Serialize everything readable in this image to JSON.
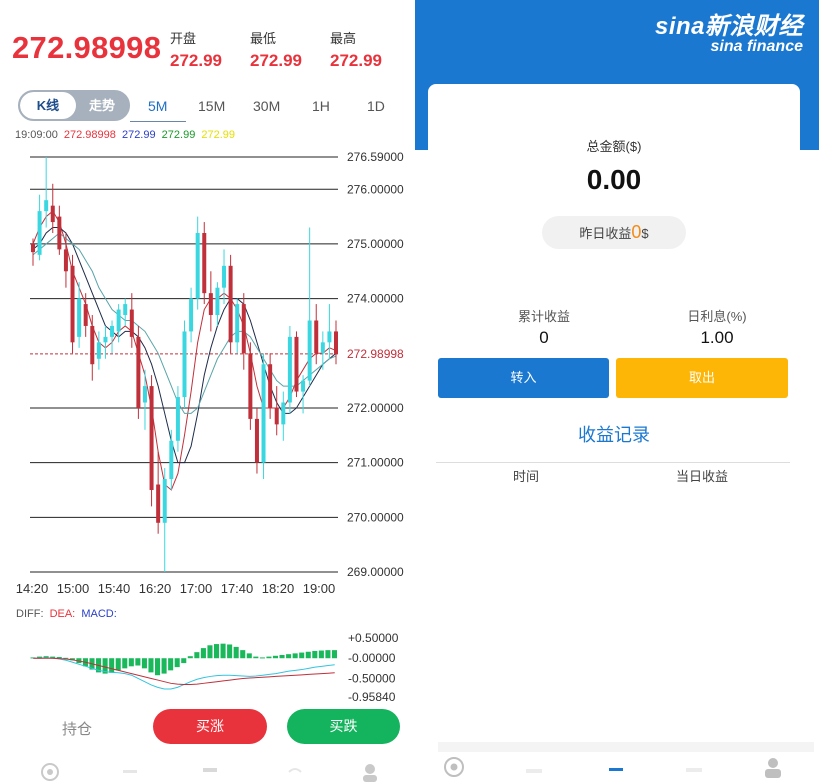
{
  "quote": {
    "price": "272.98998",
    "open_label": "开盘",
    "open_value": "272.99",
    "low_label": "最低",
    "low_value": "272.99",
    "high_label": "最高",
    "high_value": "272.99"
  },
  "chart_toggle": {
    "kline": "K线",
    "trend": "走势"
  },
  "timeframes": [
    "5M",
    "15M",
    "30M",
    "1H",
    "1D"
  ],
  "ma_legend": {
    "time": "19:09:00",
    "v1": "272.98998",
    "v1_color": "#e8333c",
    "v2": "272.99",
    "v2_color": "#2a3fc8",
    "v3": "272.99",
    "v3_color": "#1a9a2a",
    "v4": "272.99",
    "v4_color": "#e6e000"
  },
  "chart_data": [
    {
      "type": "candlestick",
      "title": "",
      "y_tick_labels": [
        "276.59000",
        "276.00000",
        "275.00000",
        "274.00000",
        "272.98998",
        "272.00000",
        "271.00000",
        "270.00000",
        "269.00000"
      ],
      "x_tick_labels": [
        "14:20",
        "15:00",
        "15:40",
        "16:20",
        "17:00",
        "17:40",
        "18:20",
        "19:00"
      ],
      "ylim": [
        269.0,
        276.59
      ],
      "current_price": 272.98998,
      "up_color": "#3ad7e0",
      "down_color": "#c0303a",
      "candles": [
        [
          275.0,
          275.1,
          274.6,
          274.85
        ],
        [
          274.8,
          275.9,
          274.7,
          275.6
        ],
        [
          275.6,
          276.59,
          275.3,
          275.8
        ],
        [
          275.7,
          276.1,
          275.2,
          275.4
        ],
        [
          275.5,
          275.7,
          274.8,
          274.9
        ],
        [
          274.9,
          275.2,
          274.2,
          274.5
        ],
        [
          274.6,
          274.8,
          273.0,
          273.2
        ],
        [
          273.3,
          274.3,
          273.1,
          274.0
        ],
        [
          273.9,
          274.1,
          273.3,
          273.5
        ],
        [
          273.5,
          273.7,
          272.5,
          272.8
        ],
        [
          272.9,
          273.4,
          272.7,
          273.2
        ],
        [
          273.2,
          273.5,
          272.9,
          273.3
        ],
        [
          273.3,
          273.6,
          273.0,
          273.5
        ],
        [
          273.4,
          273.9,
          273.2,
          273.8
        ],
        [
          273.7,
          274.0,
          273.5,
          273.9
        ],
        [
          273.8,
          274.1,
          273.1,
          273.3
        ],
        [
          273.3,
          273.5,
          271.8,
          272.0
        ],
        [
          272.1,
          272.7,
          271.6,
          272.4
        ],
        [
          272.4,
          272.6,
          270.2,
          270.5
        ],
        [
          270.6,
          271.2,
          269.7,
          269.9
        ],
        [
          269.9,
          270.9,
          269.0,
          270.7
        ],
        [
          270.7,
          271.6,
          270.5,
          271.4
        ],
        [
          271.4,
          272.4,
          271.2,
          272.2
        ],
        [
          272.2,
          273.6,
          272.0,
          273.4
        ],
        [
          273.4,
          274.2,
          273.2,
          274.0
        ],
        [
          274.0,
          275.5,
          273.8,
          275.2
        ],
        [
          275.2,
          275.4,
          273.9,
          274.1
        ],
        [
          274.1,
          274.5,
          273.4,
          273.7
        ],
        [
          273.7,
          274.3,
          273.5,
          274.2
        ],
        [
          274.2,
          274.9,
          273.9,
          274.6
        ],
        [
          274.6,
          274.8,
          273.0,
          273.2
        ],
        [
          273.2,
          274.0,
          273.0,
          273.9
        ],
        [
          273.9,
          274.1,
          272.7,
          273.0
        ],
        [
          273.0,
          273.2,
          271.6,
          271.8
        ],
        [
          271.8,
          272.0,
          270.8,
          271.0
        ],
        [
          271.0,
          273.0,
          270.7,
          272.8
        ],
        [
          272.8,
          273.0,
          271.8,
          272.0
        ],
        [
          272.0,
          272.4,
          271.5,
          271.7
        ],
        [
          271.7,
          272.3,
          271.4,
          272.1
        ],
        [
          272.1,
          273.5,
          271.9,
          273.3
        ],
        [
          273.3,
          273.4,
          272.2,
          272.3
        ],
        [
          272.3,
          272.6,
          271.9,
          272.5
        ],
        [
          272.5,
          275.3,
          272.4,
          273.6
        ],
        [
          273.6,
          273.9,
          272.8,
          273.0
        ],
        [
          273.0,
          273.4,
          272.7,
          273.2
        ],
        [
          273.2,
          273.9,
          272.9,
          273.4
        ],
        [
          273.4,
          273.6,
          272.8,
          272.99
        ]
      ],
      "ma_series": [
        {
          "color": "#c0303a",
          "values": [
            275.0,
            275.3,
            275.5,
            275.6,
            275.4,
            275.0,
            274.5,
            274.2,
            273.9,
            273.5,
            273.2,
            273.1,
            273.2,
            273.4,
            273.5,
            273.4,
            273.0,
            272.6,
            272.0,
            271.2,
            270.6,
            270.5,
            270.8,
            271.5,
            272.3,
            273.2,
            273.8,
            274.0,
            274.0,
            274.1,
            274.0,
            273.8,
            273.5,
            273.0,
            272.4,
            272.0,
            272.0,
            272.0,
            272.0,
            272.2,
            272.5,
            272.7,
            272.9,
            273.0,
            273.0,
            273.1,
            273.05
          ]
        },
        {
          "color": "#1d2b4a",
          "values": [
            274.9,
            275.0,
            275.2,
            275.3,
            275.3,
            275.2,
            275.0,
            274.7,
            274.4,
            274.1,
            273.8,
            273.5,
            273.4,
            273.3,
            273.4,
            273.4,
            273.3,
            273.1,
            272.8,
            272.4,
            271.9,
            271.4,
            271.0,
            271.0,
            271.3,
            271.9,
            272.6,
            273.1,
            273.5,
            273.8,
            274.0,
            274.0,
            273.9,
            273.6,
            273.2,
            272.8,
            272.4,
            272.1,
            271.9,
            271.9,
            272.0,
            272.2,
            272.4,
            272.6,
            272.8,
            272.9,
            273.0
          ]
        },
        {
          "color": "#5aa4a8",
          "values": [
            274.8,
            274.9,
            275.0,
            275.1,
            275.2,
            275.1,
            275.0,
            274.9,
            274.7,
            274.5,
            274.2,
            274.0,
            273.8,
            273.7,
            273.6,
            273.6,
            273.5,
            273.4,
            273.2,
            273.0,
            272.7,
            272.4,
            272.1,
            271.9,
            271.9,
            272.0,
            272.3,
            272.6,
            272.9,
            273.1,
            273.3,
            273.4,
            273.4,
            273.3,
            273.1,
            272.9,
            272.7,
            272.5,
            272.4,
            272.4,
            272.4,
            272.5,
            272.6,
            272.7,
            272.8,
            272.9,
            272.95
          ]
        }
      ]
    },
    {
      "type": "bar",
      "title": "MACD",
      "legend": [
        "DIFF:",
        "DEA:",
        "MACD:"
      ],
      "legend_colors": [
        "#555555",
        "#e8333c",
        "#2a3fc8"
      ],
      "y_tick_labels": [
        "+0.50000",
        "-0.00000",
        "-0.50000",
        "-0.95840"
      ],
      "ylim": [
        -0.9584,
        0.5
      ],
      "positive_color": "#19b85a",
      "negative_color": "#19b85a",
      "values": [
        0.02,
        0.04,
        0.05,
        0.04,
        0.03,
        0.01,
        -0.05,
        -0.12,
        -0.2,
        -0.28,
        -0.35,
        -0.38,
        -0.36,
        -0.3,
        -0.25,
        -0.2,
        -0.18,
        -0.25,
        -0.35,
        -0.42,
        -0.38,
        -0.3,
        -0.22,
        -0.12,
        0.05,
        0.15,
        0.25,
        0.32,
        0.35,
        0.36,
        0.34,
        0.28,
        0.2,
        0.12,
        0.04,
        0.02,
        0.04,
        0.06,
        0.08,
        0.1,
        0.12,
        0.14,
        0.16,
        0.18,
        0.19,
        0.2,
        0.2
      ],
      "diff_values": [
        0.0,
        0.0,
        0.01,
        0.0,
        -0.02,
        -0.05,
        -0.1,
        -0.15,
        -0.2,
        -0.25,
        -0.3,
        -0.33,
        -0.35,
        -0.36,
        -0.38,
        -0.42,
        -0.5,
        -0.58,
        -0.66,
        -0.72,
        -0.76,
        -0.76,
        -0.72,
        -0.65,
        -0.58,
        -0.52,
        -0.48,
        -0.45,
        -0.43,
        -0.42,
        -0.42,
        -0.43,
        -0.44,
        -0.45,
        -0.44,
        -0.42,
        -0.4,
        -0.38,
        -0.35,
        -0.32,
        -0.3,
        -0.28,
        -0.25,
        -0.22,
        -0.2,
        -0.18,
        -0.16
      ],
      "dea_values": [
        0.0,
        0.0,
        0.0,
        0.0,
        -0.01,
        -0.02,
        -0.04,
        -0.07,
        -0.1,
        -0.14,
        -0.18,
        -0.22,
        -0.26,
        -0.3,
        -0.34,
        -0.38,
        -0.42,
        -0.46,
        -0.5,
        -0.54,
        -0.58,
        -0.62,
        -0.64,
        -0.65,
        -0.65,
        -0.64,
        -0.62,
        -0.6,
        -0.58,
        -0.56,
        -0.54,
        -0.52,
        -0.5,
        -0.49,
        -0.48,
        -0.47,
        -0.46,
        -0.45,
        -0.44,
        -0.43,
        -0.42,
        -0.41,
        -0.4,
        -0.39,
        -0.38,
        -0.37,
        -0.36
      ]
    }
  ],
  "actions": {
    "hold": "持仓",
    "buy_up": "买涨",
    "buy_down": "买跌"
  },
  "right": {
    "logo_cn": "新浪财经",
    "logo_sina": "sina",
    "logo_en": "sina finance",
    "total_label": "总金额($)",
    "total_value": "0.00",
    "yesterday_label": "昨日收益",
    "yesterday_value": "0",
    "yesterday_unit": "$",
    "cumulative_label": "累计收益",
    "cumulative_value": "0",
    "daily_rate_label": "日利息(%)",
    "daily_rate_value": "1.00",
    "transfer_in": "转入",
    "withdraw": "取出",
    "records_title": "收益记录",
    "col_time": "时间",
    "col_day_income": "当日收益"
  }
}
